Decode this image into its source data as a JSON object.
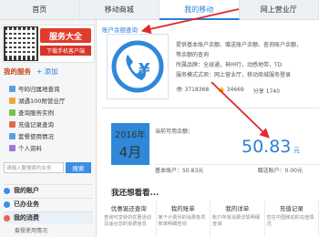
{
  "tabs": [
    {
      "label": "首页"
    },
    {
      "label": "移动商城"
    },
    {
      "label": "我的移动"
    },
    {
      "label": "网上营业厅"
    }
  ],
  "promo": {
    "badge": "服务大全",
    "sub": "下载手机客户端"
  },
  "my_services": {
    "title": "我的服务",
    "add_label": "+ 添加",
    "items": [
      {
        "label": "号码归属地查询",
        "color": "#5aa0e6"
      },
      {
        "label": "湖遇100附营业厅",
        "color": "#f0a63a"
      },
      {
        "label": "查询服务实例",
        "color": "#7abf4a"
      },
      {
        "label": "充值记录查询",
        "color": "#e06a4a"
      },
      {
        "label": "套餐使用情况",
        "color": "#5aa0e6"
      },
      {
        "label": "个人资料",
        "color": "#9b7ad6"
      }
    ],
    "search_placeholder": "请输入要搜索的业务",
    "search_button": "搜索"
  },
  "nav_groups": [
    {
      "label": "我的账户",
      "color": "#3a8ee6"
    },
    {
      "label": "已办业务",
      "color": "#3a8ee6"
    },
    {
      "label": "我的消费",
      "color": "#e06a4a"
    }
  ],
  "nav_subitem": "套餐使用情况",
  "breadcrumb": "账户余额查询",
  "info_lines": [
    "提供基本账户余额、赠送账户余额、查询账户余额，",
    "等余额的查询",
    "所属品牌：全球通，神州行，动感地带，TD",
    "服务模式式项：网上营业厅，移动商城服务登录"
  ],
  "stats": {
    "views": "3718368",
    "likes": "34669",
    "shares": "1740"
  },
  "date": {
    "year": "2016年",
    "month": "4月"
  },
  "balance": {
    "label": "当前可用余额：",
    "value": "50.83",
    "unit": "元",
    "basic_label": "基本账户：50.83元",
    "gift_label": "赠送账户：0.00元"
  },
  "see_also": {
    "title": "我还想看看...",
    "cards": [
      {
        "title": "优惠诞还查询",
        "desc": "查询可享受的优惠活动及适合您的资费信息"
      },
      {
        "title": "我的账单",
        "desc": "某个计费月的消费各项账单明细查询"
      },
      {
        "title": "我的详单",
        "desc": "账户所有消费详情明细查询"
      },
      {
        "title": "充值记录",
        "desc": "您在中国移动的充值情况"
      }
    ]
  }
}
